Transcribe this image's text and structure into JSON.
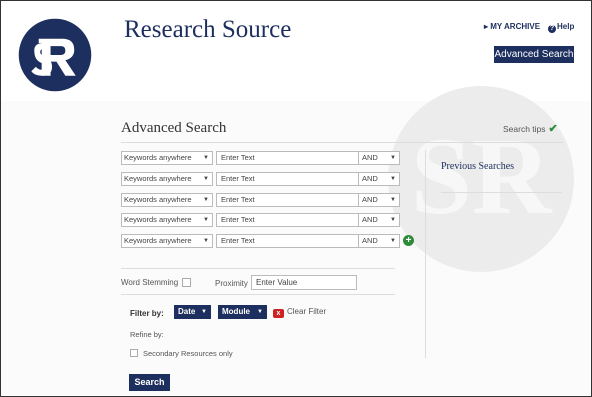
{
  "header": {
    "title": "Research Source",
    "my_archive": "▸ MY ARCHIVE",
    "help": "Help",
    "help_icon": "?",
    "advanced_search_button": "Advanced Search"
  },
  "brand": {
    "logo_letters": "SR",
    "color": "#1d2f5e"
  },
  "page": {
    "heading": "Advanced Search",
    "search_tips": "Search tips",
    "search_tips_icon": "✔"
  },
  "query_rows": [
    {
      "field": "Keywords anywhere",
      "text_placeholder": "Enter Text",
      "operator": "AND"
    },
    {
      "field": "Keywords anywhere",
      "text_placeholder": "Enter Text",
      "operator": "AND"
    },
    {
      "field": "Keywords anywhere",
      "text_placeholder": "Enter Text",
      "operator": "AND"
    },
    {
      "field": "Keywords anywhere",
      "text_placeholder": "Enter Text",
      "operator": "AND"
    },
    {
      "field": "Keywords anywhere",
      "text_placeholder": "Enter Text",
      "operator": "AND"
    }
  ],
  "add_row_icon": "+",
  "dropdown_arrow": "▼",
  "previous_searches": {
    "heading": "Previous Searches"
  },
  "options": {
    "word_stemming": "Word Stemming",
    "proximity": "Proximity",
    "proximity_placeholder": "Enter Value"
  },
  "filters": {
    "label": "Filter by:",
    "date": "Date",
    "module": "Module",
    "clear_filter": "Clear Filter",
    "clear_icon": "x",
    "refine_by": "Refine by:",
    "secondary_only": "Secondary Resources only"
  },
  "search_button": "Search"
}
